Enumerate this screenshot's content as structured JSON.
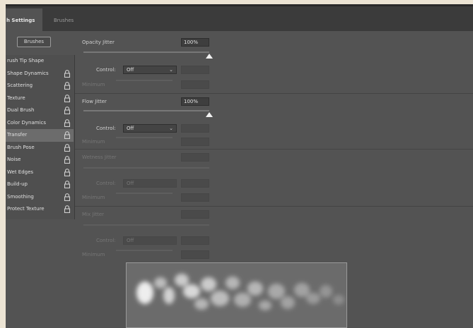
{
  "tabs": {
    "active": "h Settings",
    "inactive": "Brushes"
  },
  "brushes_button": "Brushes",
  "options": [
    {
      "label": "rush Tip Shape",
      "lock": false,
      "selected": false
    },
    {
      "label": "Shape Dynamics",
      "lock": true,
      "selected": false
    },
    {
      "label": "Scattering",
      "lock": true,
      "selected": false
    },
    {
      "label": "Texture",
      "lock": true,
      "selected": false
    },
    {
      "label": "Dual Brush",
      "lock": true,
      "selected": false
    },
    {
      "label": "Color Dynamics",
      "lock": true,
      "selected": false
    },
    {
      "label": "Transfer",
      "lock": true,
      "selected": true
    },
    {
      "label": "Brush Pose",
      "lock": true,
      "selected": false
    },
    {
      "label": "Noise",
      "lock": true,
      "selected": false
    },
    {
      "label": "Wet Edges",
      "lock": true,
      "selected": false
    },
    {
      "label": "Build-up",
      "lock": true,
      "selected": false
    },
    {
      "label": "Smoothing",
      "lock": true,
      "selected": false
    },
    {
      "label": "Protect Texture",
      "lock": true,
      "selected": false
    }
  ],
  "opacity": {
    "label": "Opacity Jitter",
    "value": "100%",
    "level": 1.0,
    "control_label": "Control:",
    "control_value": "Off",
    "minimum_label": "Minimum"
  },
  "flow": {
    "label": "Flow Jitter",
    "value": "100%",
    "level": 1.0,
    "control_label": "Control:",
    "control_value": "Off",
    "minimum_label": "Minimum"
  },
  "wetness": {
    "label": "Wetness Jitter",
    "control_label": "Control:",
    "control_value": "Off",
    "minimum_label": "Minimum"
  },
  "mix": {
    "label": "Mix Jitter",
    "control_label": "Control:",
    "control_value": "Off",
    "minimum_label": "Minimum"
  },
  "colors": {
    "panel_bg": "#535353",
    "tab_bar": "#3b3b3b",
    "selected_row": "#6c6c6c",
    "preview_bg": "#6b6b6b"
  },
  "icons": {
    "lock": "lock-icon",
    "dropdown": "chevron-down-icon",
    "slider_thumb": "slider-thumb-icon"
  }
}
